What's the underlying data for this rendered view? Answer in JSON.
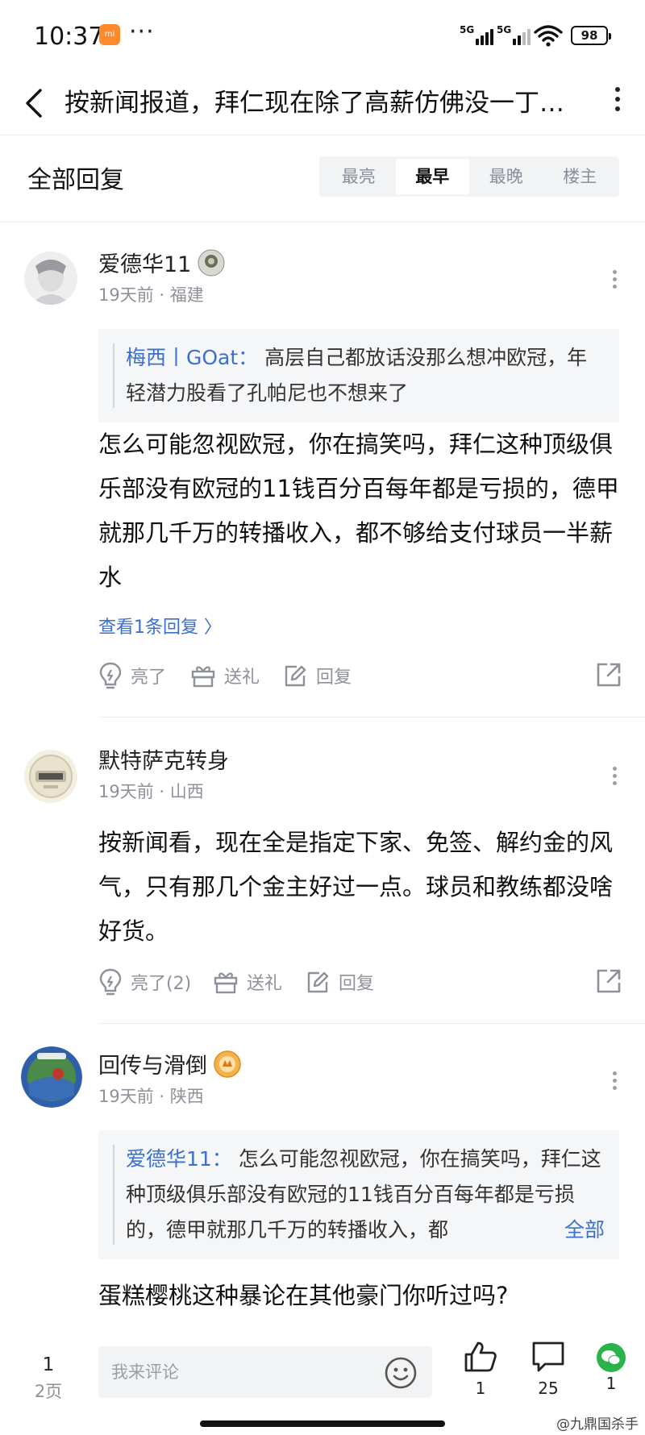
{
  "status_bar": {
    "time": "10:37",
    "app_icon": "mi-store-icon",
    "dots": "···",
    "network1": "5G",
    "network2": "5G",
    "battery": "98"
  },
  "header": {
    "title": "按新闻报道，拜仁现在除了高薪仿佛没一丁…"
  },
  "replies": {
    "title": "全部回复",
    "sort_options": [
      "最亮",
      "最早",
      "最晚",
      "楼主"
    ],
    "active_sort": "最早"
  },
  "comments": [
    {
      "username": "爱德华11",
      "time": "19天前",
      "location": "福建",
      "quote_author": "梅西丨GOat：",
      "quote_text": "高层自己都放话没那么想冲欧冠，年轻潜力股看了孔帕尼也不想来了",
      "body": "怎么可能忽视欧冠，你在搞笑吗，拜仁这种顶级俱乐部没有欧冠的11钱百分百每年都是亏损的，德甲就那几千万的转播收入，都不够给支付球员一半薪水",
      "view_replies": "查看1条回复 〉",
      "like_label": "亮了",
      "gift_label": "送礼",
      "reply_label": "回复"
    },
    {
      "username": "默特萨克转身",
      "time": "19天前",
      "location": "山西",
      "body": "按新闻看，现在全是指定下家、免签、解约金的风气，只有那几个金主好过一点。球员和教练都没啥好货。",
      "like_label": "亮了(2)",
      "gift_label": "送礼",
      "reply_label": "回复"
    },
    {
      "username": "回传与滑倒",
      "time": "19天前",
      "location": "陕西",
      "quote_author": "爱德华11：",
      "quote_text": "怎么可能忽视欧冠，你在搞笑吗，拜仁这种顶级俱乐部没有欧冠的11钱百分百每年都是亏损的，德甲就那几千万的转播收入，都",
      "quote_more": "全部",
      "body": "蛋糕樱桃这种暴论在其他豪门你听过吗?"
    }
  ],
  "bottom_bar": {
    "page_current": "1",
    "page_total": "2页",
    "input_placeholder": "我来评论",
    "like_count": "1",
    "comment_count": "25",
    "share_count": "1"
  },
  "watermark": "@九鼎国杀手",
  "colors": {
    "link_blue": "#3b6fd0",
    "meta_gray": "#8d9199",
    "wechat_green": "#2ab34a"
  }
}
